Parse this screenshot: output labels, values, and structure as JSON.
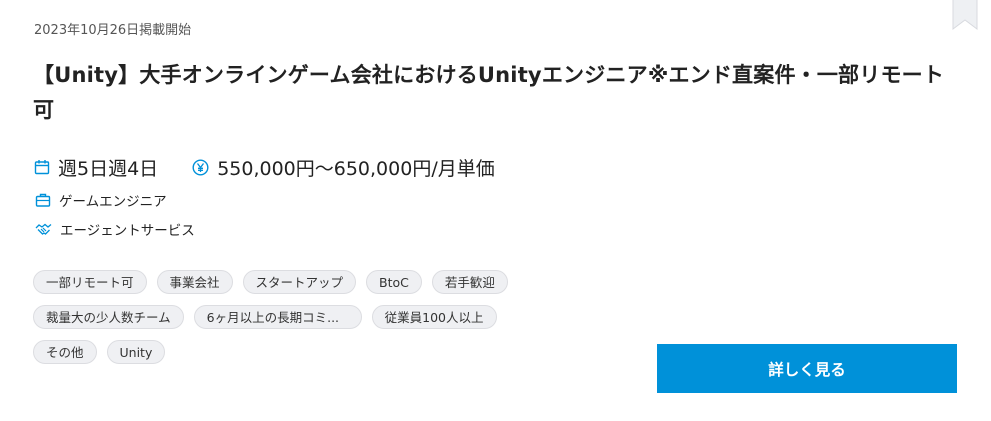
{
  "job": {
    "posted_date": "2023年10月26日掲載開始",
    "title": "【Unity】大手オンラインゲーム会社におけるUnityエンジニア※エンド直案件・一部リモート可",
    "schedule": "週5日週4日",
    "price": "550,000円〜650,000円/月単価",
    "job_type": "ゲームエンジニア",
    "service": "エージェントサービス",
    "tags": [
      "一部リモート可",
      "事業会社",
      "スタートアップ",
      "BtoC",
      "若手歓迎",
      "裁量大の少人数チーム",
      "6ヶ月以上の長期コミ...",
      "従業員100人以上",
      "その他",
      "Unity"
    ],
    "detail_button": "詳しく見る"
  },
  "icons": {
    "bookmark": "bookmark-icon",
    "schedule": "calendar-icon",
    "price": "yen-icon",
    "job_type": "briefcase-icon",
    "service": "handshake-icon"
  },
  "colors": {
    "accent": "#0091d9",
    "tag_bg": "#eff0f3",
    "text": "#222222"
  }
}
